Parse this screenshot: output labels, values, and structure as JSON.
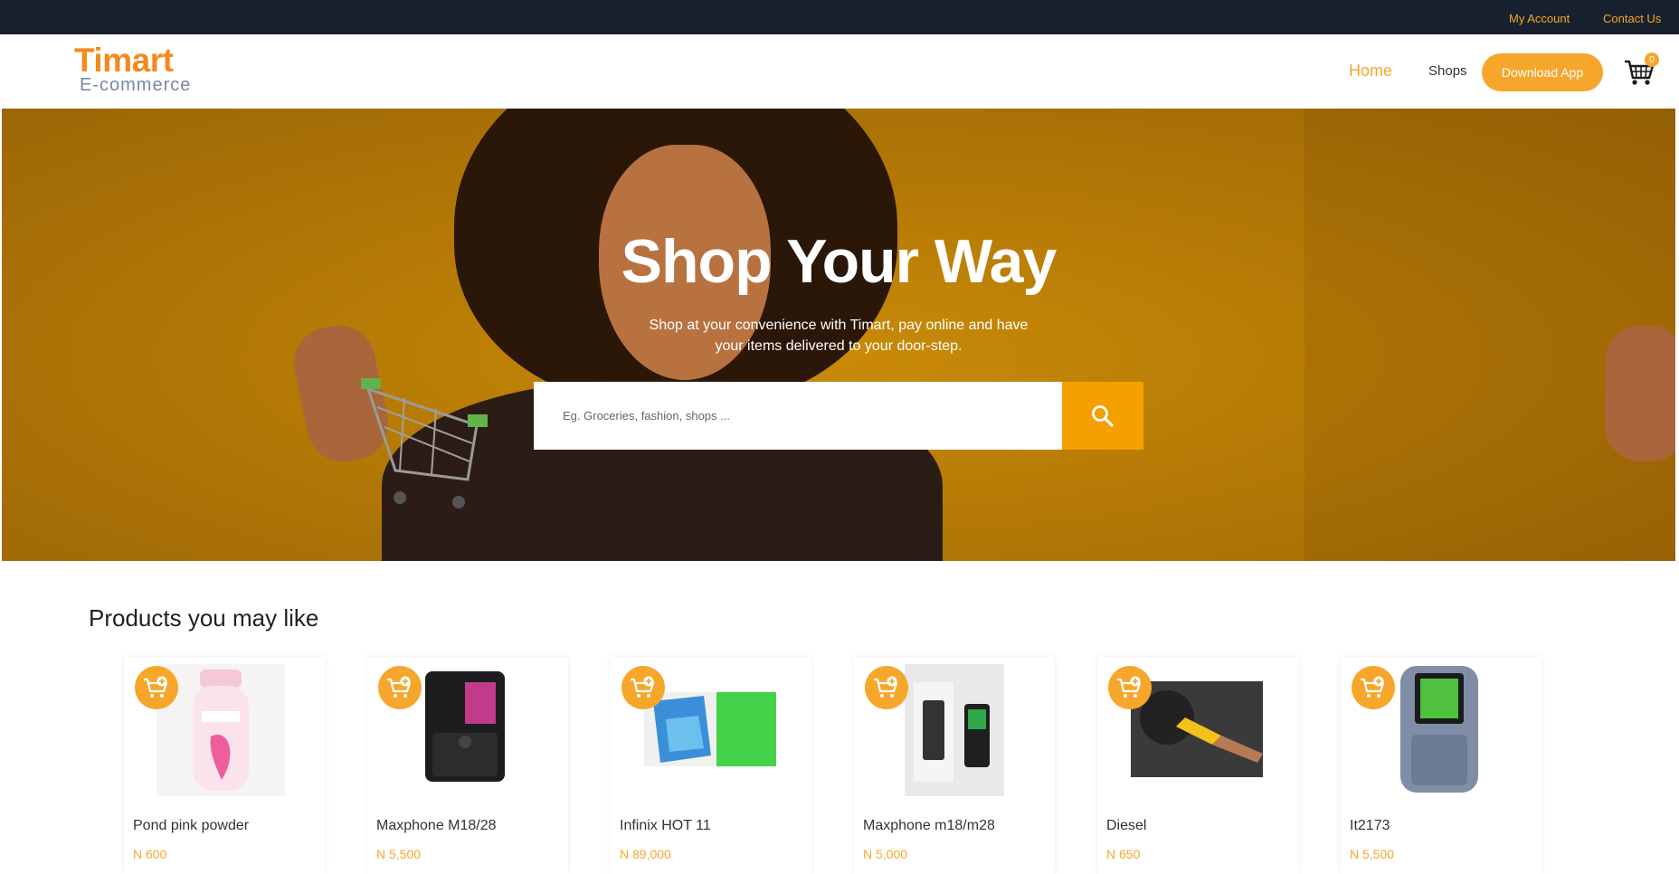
{
  "topbar": {
    "my_account": "My Account",
    "contact_us": "Contact Us"
  },
  "header": {
    "logo_title": "Timart",
    "logo_sub": "E-commerce",
    "nav": {
      "home": "Home",
      "shops": "Shops"
    },
    "download_app": "Download App",
    "cart_count": "0"
  },
  "hero": {
    "title": "Shop Your Way",
    "subtitle": "Shop at your convenience with Timart, pay online and have your items delivered to your door-step.",
    "search_placeholder": "Eg. Groceries, fashion, shops ..."
  },
  "products": {
    "heading": "Products you may like",
    "items": [
      {
        "name": "Pond pink powder",
        "price": "N 600"
      },
      {
        "name": "Maxphone M18/28",
        "price": "N 5,500"
      },
      {
        "name": "Infinix HOT 11",
        "price": "N 89,000"
      },
      {
        "name": "Maxphone m18/m28",
        "price": "N 5,000"
      },
      {
        "name": "Diesel",
        "price": "N 650"
      },
      {
        "name": "It2173",
        "price": "N 5,500"
      }
    ]
  },
  "colors": {
    "accent": "#f6a72b",
    "topbar": "#18202e",
    "hero": "#c98a08"
  },
  "icons": [
    "cart-icon",
    "search-icon",
    "add-to-cart-icon"
  ]
}
